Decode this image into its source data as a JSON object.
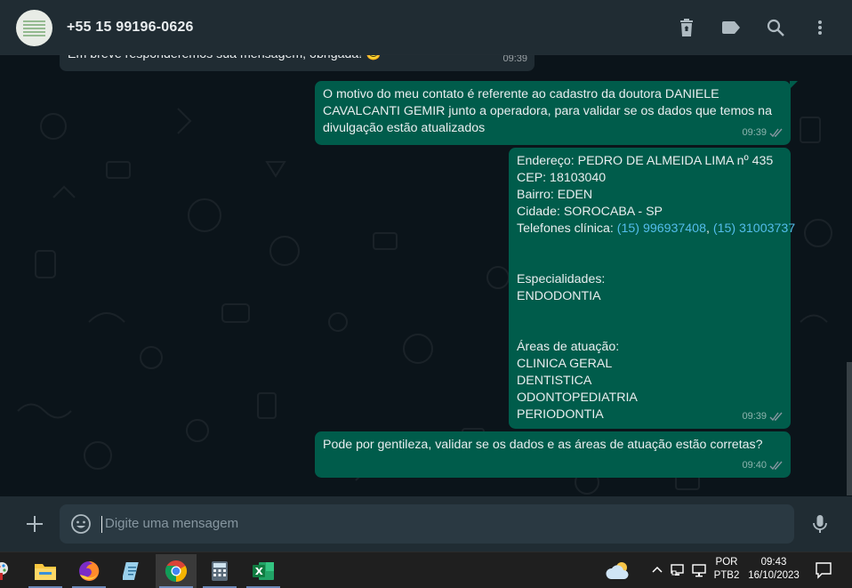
{
  "header": {
    "contact_name": "+55 15 99196-0626",
    "icons": [
      "delete-icon",
      "label-icon",
      "search-icon",
      "menu-icon"
    ]
  },
  "messages": [
    {
      "direction": "in",
      "lines": [
        "Em breve responderemos sua mensagem, obrigada! 😊"
      ],
      "time": "09:39"
    },
    {
      "direction": "out",
      "lines": [
        "O motivo do meu contato é referente ao cadastro da doutora DANIELE",
        "CAVALCANTI GEMIR junto a operadora, para validar se os dados que temos na",
        "divulgação estão atualizados"
      ],
      "time": "09:39",
      "status": "read"
    },
    {
      "direction": "out",
      "address": "Endereço: PEDRO DE ALMEIDA LIMA nº 435",
      "cep": "CEP: 18103040",
      "bairro": "Bairro: EDEN",
      "cidade": "Cidade: SOROCABA - SP",
      "phones_label": "Telefones clínica: ",
      "phone1": "(15) 996937408",
      "phone_sep": ", ",
      "phone2": "(15) 31003737",
      "especialidades_label": "Especialidades:",
      "especialidade": "ENDODONTIA",
      "areas_label": "Áreas de atuação:",
      "areas": [
        "CLINICA GERAL",
        "DENTISTICA",
        "ODONTOPEDIATRIA",
        "PERIODONTIA"
      ],
      "time": "09:39",
      "status": "read"
    },
    {
      "direction": "out",
      "lines": [
        "Pode por gentileza, validar se os dados e as áreas de atuação estão corretas?"
      ],
      "time": "09:40",
      "status": "read"
    }
  ],
  "composer": {
    "placeholder": "Digite uma mensagem"
  },
  "taskbar": {
    "apps": [
      "paint-icon",
      "file-explorer-icon",
      "firefox-icon",
      "notepad-icon",
      "chrome-icon",
      "calculator-icon",
      "excel-icon"
    ],
    "active_app": "chrome-icon",
    "lang_top": "POR",
    "lang_bottom": "PTB2",
    "clock_time": "09:43",
    "clock_date": "16/10/2023"
  },
  "colors": {
    "header_bg": "#202c33",
    "chat_bg": "#0b141a",
    "outgoing_bubble": "#005c4b",
    "incoming_bubble": "#202c33",
    "link": "#53bdeb",
    "read_ticks": "#8696a0"
  }
}
